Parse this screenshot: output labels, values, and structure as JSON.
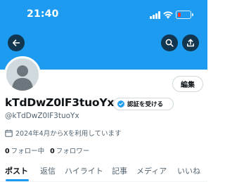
{
  "status_bar": {
    "time": "21:40",
    "battery_color": "#ff3b30"
  },
  "header": {
    "banner_color": "#1d9bf0",
    "back_icon": "arrow-left-icon",
    "search_icon": "search-icon",
    "share_icon": "share-icon"
  },
  "profile": {
    "display_name": "kTdDwZ0lF3tuoYx",
    "handle": "@kTdDwZ0lF3tuoYx",
    "edit_label": "編集",
    "verify_label": "認証を受ける",
    "joined": "2024年4月からXを利用しています",
    "following_count": "0",
    "following_label": "フォロー中",
    "followers_count": "0",
    "followers_label": "フォロワー"
  },
  "tabs": [
    {
      "label": "ポスト",
      "active": true
    },
    {
      "label": "返信",
      "active": false
    },
    {
      "label": "ハイライト",
      "active": false
    },
    {
      "label": "記事",
      "active": false
    },
    {
      "label": "メディア",
      "active": false
    },
    {
      "label": "いいね",
      "active": false
    }
  ],
  "accent_color": "#1d9bf0"
}
